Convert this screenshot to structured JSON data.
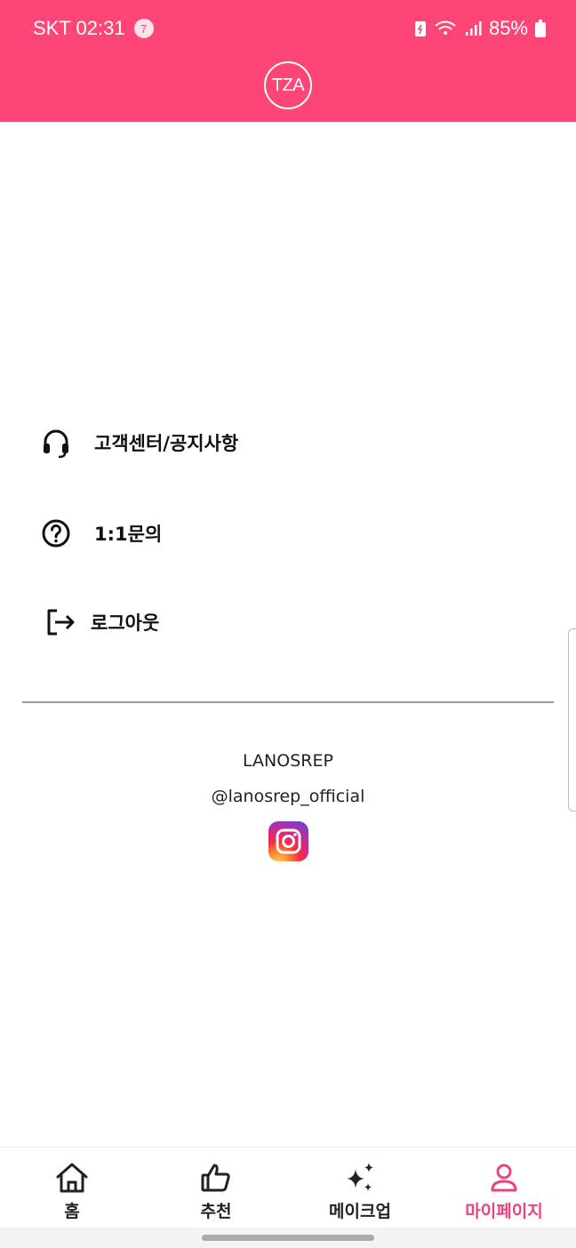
{
  "status_bar": {
    "carrier_time": "SKT 02:31",
    "notification_count": "7",
    "battery": "85%"
  },
  "header": {
    "logo_text": "TZA"
  },
  "menu": {
    "items": [
      {
        "label": "고객센터/공지사항",
        "icon": "headset-icon"
      },
      {
        "label": "1:1문의",
        "icon": "question-circle-icon"
      },
      {
        "label": "로그아웃",
        "icon": "logout-icon"
      }
    ]
  },
  "footer": {
    "brand": "LANOSREP",
    "handle": "@lanosrep_official",
    "social_icon": "instagram-icon"
  },
  "bottom_nav": {
    "items": [
      {
        "label": "홈",
        "icon": "home-icon",
        "active": false
      },
      {
        "label": "추천",
        "icon": "thumbs-up-icon",
        "active": false
      },
      {
        "label": "메이크업",
        "icon": "sparkles-icon",
        "active": false
      },
      {
        "label": "마이페이지",
        "icon": "user-icon",
        "active": true
      }
    ]
  },
  "colors": {
    "brand": "#fd4577",
    "active_nav": "#e94380"
  }
}
